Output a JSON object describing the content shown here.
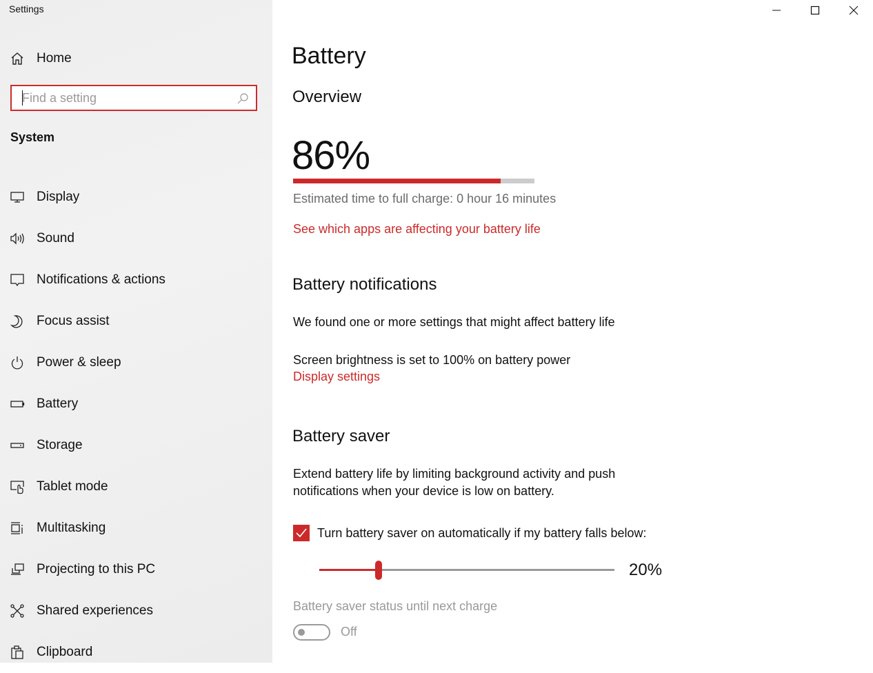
{
  "window": {
    "title": "Settings",
    "controls": {
      "minimize": "minimize-icon",
      "maximize": "maximize-icon",
      "close": "close-icon"
    }
  },
  "sidebar": {
    "home_label": "Home",
    "search_placeholder": "Find a setting",
    "section_title": "System",
    "items": [
      {
        "label": "Display",
        "icon": "display-icon"
      },
      {
        "label": "Sound",
        "icon": "speaker-icon"
      },
      {
        "label": "Notifications & actions",
        "icon": "notification-icon"
      },
      {
        "label": "Focus assist",
        "icon": "moon-icon"
      },
      {
        "label": "Power & sleep",
        "icon": "power-icon"
      },
      {
        "label": "Battery",
        "icon": "battery-icon"
      },
      {
        "label": "Storage",
        "icon": "storage-icon"
      },
      {
        "label": "Tablet mode",
        "icon": "tablet-mode-icon"
      },
      {
        "label": "Multitasking",
        "icon": "multitasking-icon"
      },
      {
        "label": "Projecting to this PC",
        "icon": "projecting-icon"
      },
      {
        "label": "Shared experiences",
        "icon": "shared-experiences-icon"
      },
      {
        "label": "Clipboard",
        "icon": "clipboard-icon"
      }
    ]
  },
  "main": {
    "title": "Battery",
    "overview": {
      "heading": "Overview",
      "percent_label": "86%",
      "charge_percent": 86,
      "estimate": "Estimated time to full charge: 0 hour 16 minutes",
      "apps_link": "See which apps are affecting your battery life"
    },
    "notifications": {
      "heading": "Battery notifications",
      "found_text": "We found one or more settings that might affect battery life",
      "brightness_text": "Screen brightness is set to 100% on battery power",
      "display_link": "Display settings"
    },
    "saver": {
      "heading": "Battery saver",
      "description_line1": "Extend battery life by limiting background activity and push",
      "description_line2": "notifications when your device is low on battery.",
      "auto_checkbox_label": "Turn battery saver on automatically if my battery falls below:",
      "auto_checked": true,
      "threshold_percent": 20,
      "threshold_label": "20%",
      "status_label": "Battery saver status until next charge",
      "status_toggle": "Off"
    }
  },
  "colors": {
    "accent": "#cc2a2a",
    "track": "#cccccc",
    "muted_text": "#6b6b6b",
    "disabled": "#9a9a9a"
  }
}
